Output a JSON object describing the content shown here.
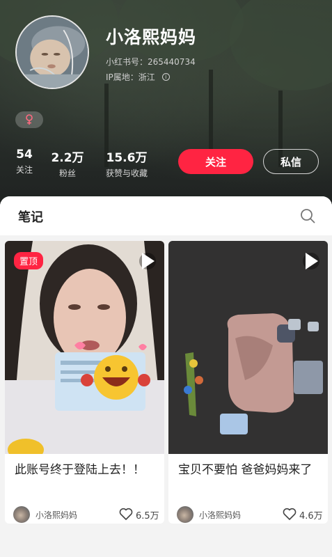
{
  "profile": {
    "nickname": "小洛熙妈妈",
    "red_id": "小红书号：265440734",
    "ip_location": "IP属地：浙江",
    "gender_icon": "female-symbol-icon"
  },
  "stats": [
    {
      "value": "54",
      "label": "关注"
    },
    {
      "value": "2.2万",
      "label": "粉丝"
    },
    {
      "value": "15.6万",
      "label": "获赞与收藏"
    }
  ],
  "actions": {
    "follow": "关注",
    "message": "私信"
  },
  "tabs": {
    "notes": "笔记"
  },
  "notes": [
    {
      "pinned_label": "置顶",
      "type_icon": "video-play-icon",
      "title": "此账号终于登陆上去！！",
      "author": "小洛熙妈妈",
      "likes": "6.5万"
    },
    {
      "type_icon": "video-play-icon",
      "title": "宝贝不要怕 爸爸妈妈来了",
      "author": "小洛熙妈妈",
      "likes": "4.6万"
    }
  ],
  "colors": {
    "accent": "#ff2442",
    "header_bg": "#2c332d",
    "panel_bg": "#f3f3f3"
  }
}
